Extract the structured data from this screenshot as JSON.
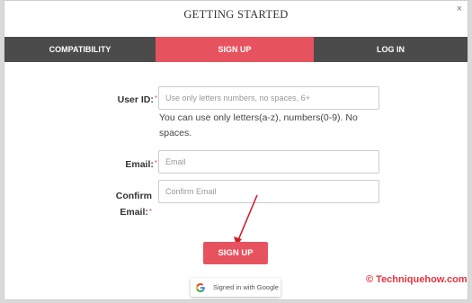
{
  "modal": {
    "title": "GETTING STARTED",
    "close_symbol": "×"
  },
  "tabs": [
    {
      "label": "COMPATIBILITY",
      "active": false
    },
    {
      "label": "SIGN UP",
      "active": true
    },
    {
      "label": "LOG IN",
      "active": false
    }
  ],
  "form": {
    "user_id": {
      "label": "User ID:",
      "required_mark": "*",
      "placeholder": "Use only letters numbers, no spaces, 6+",
      "value": "",
      "help_line1": "You can use only letters(a-z), numbers(0-9). No",
      "help_line2": "spaces."
    },
    "email": {
      "label": "Email:",
      "required_mark": "*",
      "placeholder": "Email",
      "value": ""
    },
    "confirm_email": {
      "label_line1": "Confirm",
      "label_line2": "Email:",
      "required_mark": "*",
      "placeholder": "Confirm Email",
      "value": ""
    },
    "submit_label": "SIGN UP"
  },
  "google": {
    "label": "Signed in with Google",
    "icon": "google-g-icon"
  },
  "watermark": {
    "text": "© Techniquehow.com"
  },
  "colors": {
    "accent": "#e6535e",
    "tab_inactive": "#4b4b4b"
  }
}
